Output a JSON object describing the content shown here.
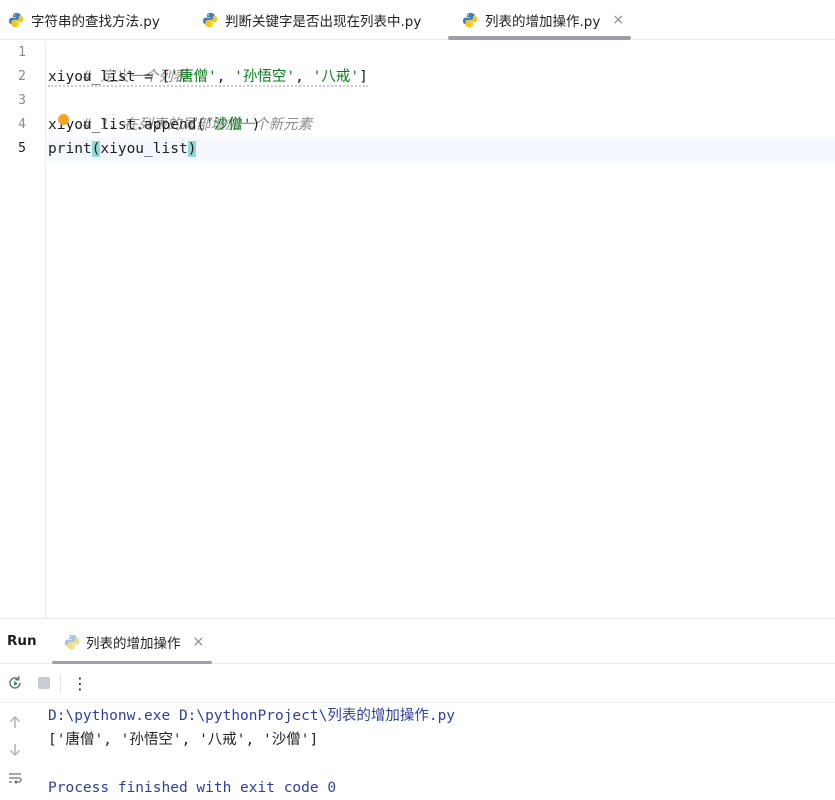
{
  "tabs": [
    {
      "label": "字符串的查找方法.py",
      "icon": "python-file-icon",
      "active": false
    },
    {
      "label": "判断关键字是否出现在列表中.py",
      "icon": "python-file-icon",
      "active": false
    },
    {
      "label": "列表的增加操作.py",
      "icon": "python-file-icon",
      "active": true,
      "close": "×"
    }
  ],
  "editor": {
    "line_numbers": [
      "1",
      "2",
      "3",
      "4",
      "5"
    ],
    "current_line": "5",
    "lines": [
      {
        "comment": "# 定义一个列表"
      },
      {
        "p1": "xiyou_list = [",
        "s1": "'唐僧'",
        "c1": ", ",
        "s2": "'孙悟空'",
        "c2": ", ",
        "s3": "'八戒'",
        "p2": "]"
      },
      {
        "comment": "# 1、在列表的尾部增加一个新元素"
      },
      {
        "p1": "xiyou_list.append(",
        "s1": "'沙僧'",
        "p2": ")"
      },
      {
        "p1": "print",
        "open": "(",
        "mid": "xiyou_list",
        "close": ")"
      }
    ]
  },
  "run_panel": {
    "title": "Run",
    "tab_label": "列表的增加操作",
    "tab_close": "×",
    "toolbar": {
      "rerun": "rerun-icon",
      "stop": "stop-icon",
      "more": "⋮"
    },
    "side_icons": [
      "arrow-up-icon",
      "arrow-down-icon",
      "soft-wrap-icon"
    ],
    "console": [
      "D:\\pythonw.exe D:\\pythonProject\\列表的增加操作.py",
      "['唐僧', '孙悟空', '八戒', '沙僧']",
      "",
      "Process finished with exit code 0"
    ]
  },
  "colors": {
    "string": "#067d17",
    "comment": "#8c8c8c",
    "console_path": "#2e3fa1",
    "bracket_highlight": "#93d9d9",
    "caret_line": "#f5f8fe"
  }
}
